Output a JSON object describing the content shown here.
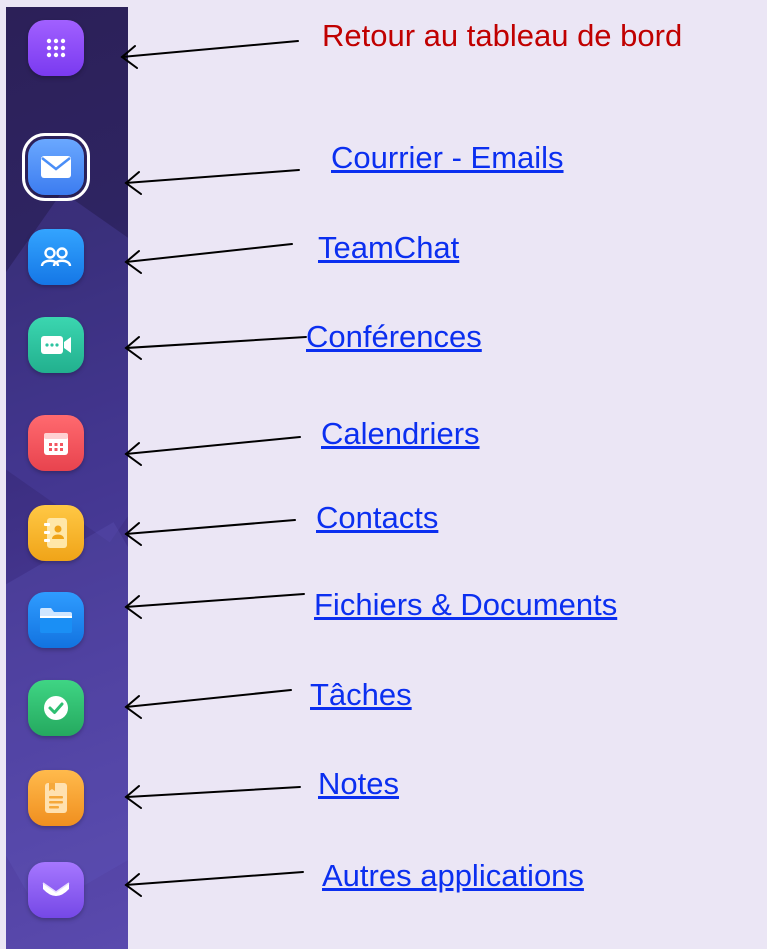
{
  "sidebar": {
    "items": [
      {
        "label": "Retour au tableau de bord",
        "icon": "grid-dashboard-icon",
        "color": "#8b4cf5",
        "link": false
      },
      {
        "label": "Courrier - Emails",
        "icon": "mail-icon",
        "color": "#4a8ef7",
        "link": true,
        "active": true
      },
      {
        "label": "TeamChat",
        "icon": "team-chat-icon",
        "color": "#1e88f5",
        "link": true
      },
      {
        "label": "Conférences",
        "icon": "video-conference-icon",
        "color": "#2cc3a0",
        "link": true
      },
      {
        "label": "Calendriers",
        "icon": "calendar-icon",
        "color": "#f25560",
        "link": true
      },
      {
        "label": "Contacts",
        "icon": "contacts-book-icon",
        "color": "#f5b52e",
        "link": true
      },
      {
        "label": "Fichiers & Documents",
        "icon": "folder-icon",
        "color": "#1a8ff5",
        "link": true
      },
      {
        "label": "Tâches",
        "icon": "task-check-icon",
        "color": "#2fbf72",
        "link": true
      },
      {
        "label": "Notes",
        "icon": "notes-icon",
        "color": "#f5a83a",
        "link": true
      },
      {
        "label": "Autres applications",
        "icon": "more-apps-icon",
        "color": "#8c5cf0",
        "link": true
      }
    ]
  },
  "colors": {
    "sidebar_background": "#2e2462",
    "page_background": "#ebe6f5",
    "link_text": "#0b2ff0",
    "title_text": "#c00000"
  }
}
